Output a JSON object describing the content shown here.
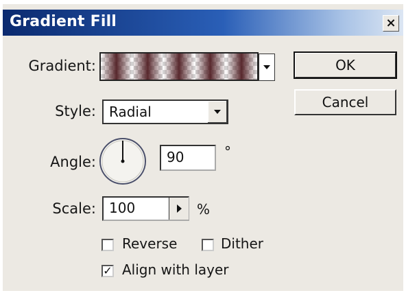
{
  "dialog": {
    "title": "Gradient Fill",
    "close_glyph": "×"
  },
  "form": {
    "gradient_label": "Gradient:",
    "style_label": "Style:",
    "style_value": "Radial",
    "angle_label": "Angle:",
    "angle_value": "90",
    "angle_unit": "°",
    "scale_label": "Scale:",
    "scale_value": "100",
    "scale_unit": "%"
  },
  "options": {
    "reverse": {
      "label": "Reverse",
      "checked": false
    },
    "dither": {
      "label": "Dither",
      "checked": false
    },
    "align_with_layer": {
      "label": "Align with layer",
      "checked": true,
      "check_glyph": "✓"
    }
  },
  "buttons": {
    "ok": "OK",
    "cancel": "Cancel"
  },
  "icons": {
    "gradient_dropdown": "chevron-down-icon",
    "style_dropdown": "chevron-down-icon",
    "scale_stepper": "play-right-icon",
    "angle_dial": "angle-dial-icon"
  },
  "colors": {
    "titlebar_start": "#0b2a6f",
    "titlebar_end": "#dce6f3",
    "dialog_bg": "#ece9e3",
    "gradient_stripe": "#501e23"
  }
}
